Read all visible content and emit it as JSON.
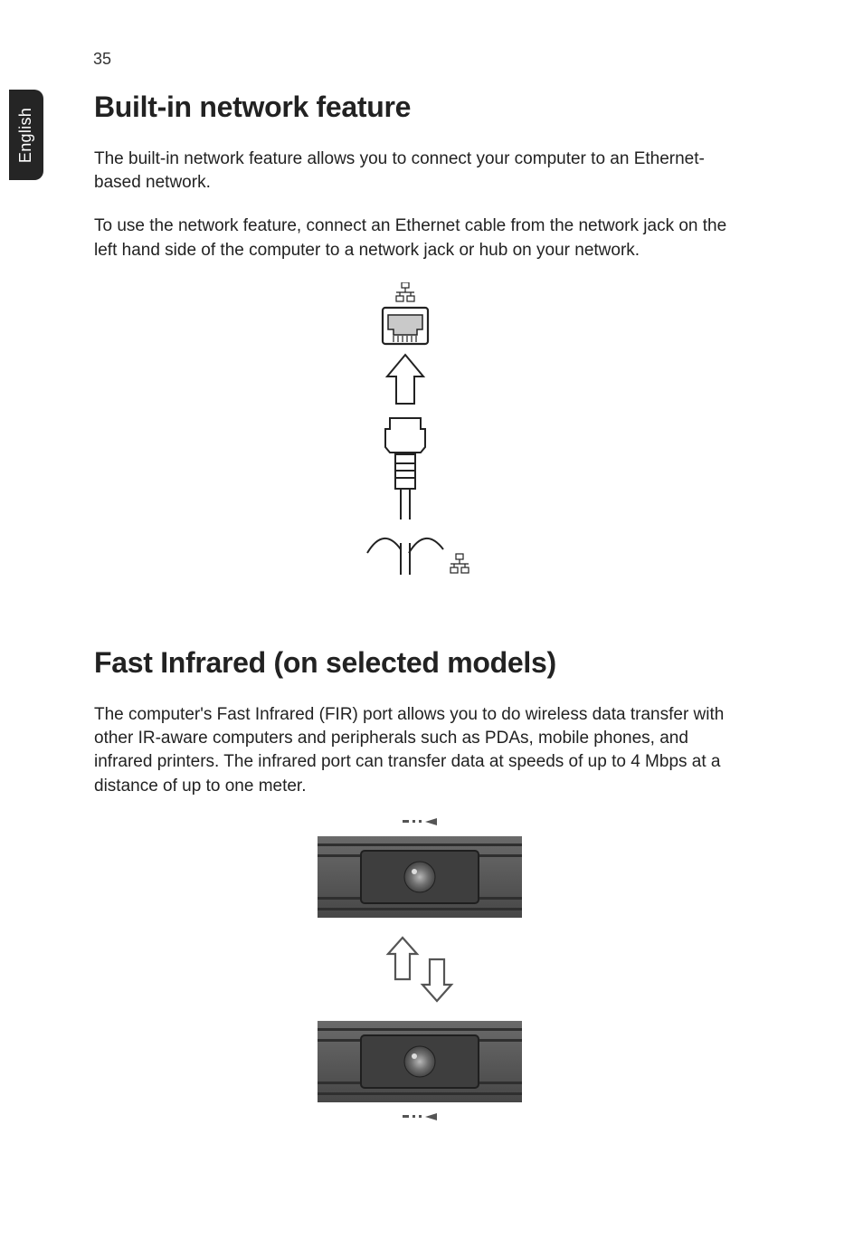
{
  "page": {
    "number": "35",
    "language_tab": "English"
  },
  "sections": [
    {
      "heading": "Built-in network feature",
      "paragraphs": [
        "The built-in network feature allows you to connect your computer to an Ethernet-based network.",
        "To use the network feature, connect an Ethernet cable from the network jack on the left hand side of the computer to a network jack or hub on your network."
      ]
    },
    {
      "heading": "Fast Infrared (on selected models)",
      "paragraphs": [
        "The computer's Fast Infrared (FIR) port allows you to do wireless data transfer with other IR-aware computers and peripherals such as PDAs, mobile phones, and infrared printers. The infrared port can transfer data at speeds of up to 4 Mbps at a distance of up to one meter."
      ]
    }
  ],
  "figures": {
    "ethernet": {
      "alt": "Ethernet port with network icon and RJ-45 cable plugging upward"
    },
    "infrared": {
      "alt": "Two infrared ports facing each other with bidirectional arrows"
    }
  }
}
